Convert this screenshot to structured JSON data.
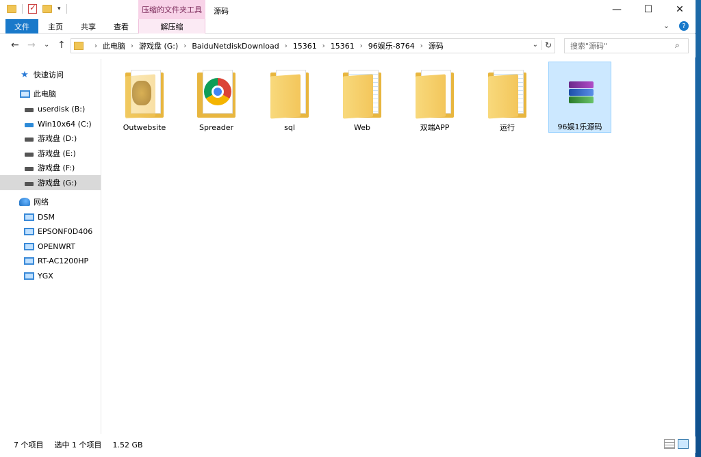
{
  "titlebar": {
    "context_group": "压缩的文件夹工具",
    "window_title": "源码",
    "min": "—",
    "max": "☐",
    "close": "✕"
  },
  "ribbon": {
    "tabs": [
      "文件",
      "主页",
      "共享",
      "查看",
      "解压缩"
    ]
  },
  "address": {
    "breadcrumbs": [
      "此电脑",
      "游戏盘 (G:)",
      "BaiduNetdiskDownload",
      "15361",
      "15361",
      "96娱乐-8764",
      "源码"
    ],
    "search_placeholder": "搜索\"源码\""
  },
  "nav": {
    "items": [
      {
        "label": "快速访问",
        "icon": "star-icon"
      },
      {
        "label": "此电脑",
        "icon": "computer-icon"
      },
      {
        "label": "userdisk (B:)",
        "icon": "drive-icon"
      },
      {
        "label": "Win10x64 (C:)",
        "icon": "system-drive-icon"
      },
      {
        "label": "游戏盘 (D:)",
        "icon": "drive-icon"
      },
      {
        "label": "游戏盘 (E:)",
        "icon": "drive-icon"
      },
      {
        "label": "游戏盘 (F:)",
        "icon": "drive-icon"
      },
      {
        "label": "游戏盘 (G:)",
        "icon": "drive-icon"
      },
      {
        "label": "网络",
        "icon": "network-icon"
      },
      {
        "label": "DSM",
        "icon": "monitor-icon"
      },
      {
        "label": "EPSONF0D406",
        "icon": "monitor-icon"
      },
      {
        "label": "OPENWRT",
        "icon": "monitor-icon"
      },
      {
        "label": "RT-AC1200HP",
        "icon": "monitor-icon"
      },
      {
        "label": "YGX",
        "icon": "monitor-icon"
      }
    ]
  },
  "files": [
    {
      "name": "Outwebsite",
      "icon": "folder-badge-icon"
    },
    {
      "name": "Spreader",
      "icon": "folder-chrome-icon"
    },
    {
      "name": "sql",
      "icon": "folder-icon"
    },
    {
      "name": "Web",
      "icon": "folder-icon"
    },
    {
      "name": "双端APP",
      "icon": "folder-icon"
    },
    {
      "name": "运行",
      "icon": "folder-icon"
    },
    {
      "name": "96娱1乐源码",
      "icon": "rar-archive-icon"
    }
  ],
  "status": {
    "count": "7 个项目",
    "selected": "选中 1 个项目",
    "size": "1.52 GB"
  }
}
